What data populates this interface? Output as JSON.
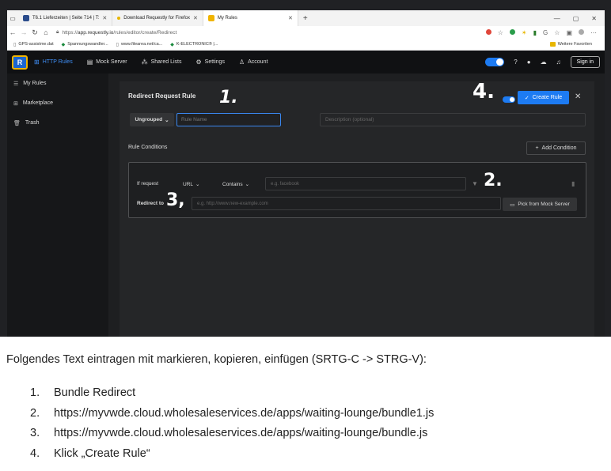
{
  "browser": {
    "tabs": [
      {
        "title": "T6.1 Lieferzeiten | Seite 714 | T:",
        "active": false,
        "favicon_color": "#2b4c8c"
      },
      {
        "title": "Download Requestly for Firefox",
        "active": false,
        "favicon_color": "#e8b600"
      },
      {
        "title": "My Rules",
        "active": true,
        "favicon_color": "#f0b400"
      }
    ],
    "url_prefix": "https://",
    "url_host": "app.requestly.io",
    "url_path": "/rules/editor/create/Redirect",
    "bookmarks": [
      {
        "label": "GPS-assistme.dat"
      },
      {
        "label": "Spannungswandler..."
      },
      {
        "label": "www.filearea.net/ca..."
      },
      {
        "label": "K-ELECTRONIC® |..."
      }
    ],
    "bookmarks_right": "Weitere Favoriten"
  },
  "app": {
    "nav": [
      {
        "label": "HTTP Rules",
        "icon": "grid-icon",
        "active": true
      },
      {
        "label": "Mock Server",
        "icon": "server-icon",
        "active": false
      },
      {
        "label": "Shared Lists",
        "icon": "share-icon",
        "active": false
      },
      {
        "label": "Settings",
        "icon": "gear-icon",
        "active": false
      },
      {
        "label": "Account",
        "icon": "user-icon",
        "active": false
      }
    ],
    "sign_in": "Sign in",
    "sidebar": [
      {
        "label": "My Rules",
        "icon": "list-icon"
      },
      {
        "label": "Marketplace",
        "icon": "store-icon"
      },
      {
        "label": "Trash",
        "icon": "trash-icon"
      }
    ],
    "editor": {
      "title": "Redirect Request Rule",
      "create_button": "Create Rule",
      "group_select": "Ungrouped",
      "rule_name_placeholder": "Rule Name",
      "description_placeholder": "Description (optional)",
      "conditions_label": "Rule Conditions",
      "add_condition": "Add Condition",
      "if_request": "If request",
      "field_select": "URL",
      "operator_select": "Contains",
      "match_placeholder": "e.g. facebook",
      "redirect_to": "Redirect to",
      "redirect_placeholder": "e.g. http://www.new-example.com",
      "pick_mock": "Pick from Mock Server"
    }
  },
  "annotations": {
    "one": "1.",
    "two": "2.",
    "three": "3,",
    "four": "4."
  },
  "document": {
    "instruction": "Folgendes Text eintragen mit markieren, kopieren, einfügen (SRTG-C -> STRG-V):",
    "steps": [
      {
        "num": "1.",
        "text": "Bundle Redirect"
      },
      {
        "num": "2.",
        "text": "https://myvwde.cloud.wholesaleservices.de/apps/waiting-lounge/bundle1.js"
      },
      {
        "num": "3.",
        "text": "https://myvwde.cloud.wholesaleservices.de/apps/waiting-lounge/bundle.js"
      },
      {
        "num": "4.",
        "text": "Klick „Create Rule“"
      }
    ]
  }
}
